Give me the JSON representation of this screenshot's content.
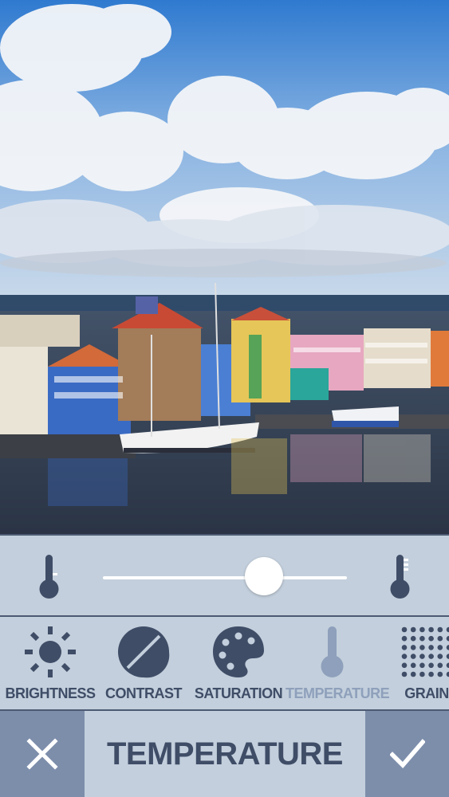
{
  "photo": {
    "description_icon": "image"
  },
  "slider": {
    "low_icon": "thermometer-low-icon",
    "high_icon": "thermometer-high-icon",
    "value": 0.66
  },
  "tools": [
    {
      "label": "BRIGHTNESS",
      "icon": "sun-icon",
      "active": false
    },
    {
      "label": "CONTRAST",
      "icon": "contrast-icon",
      "active": false
    },
    {
      "label": "SATURATION",
      "icon": "palette-icon",
      "active": false
    },
    {
      "label": "TEMPERATURE",
      "icon": "thermometer-icon",
      "active": true
    },
    {
      "label": "GRAIN",
      "icon": "grain-icon",
      "active": false
    }
  ],
  "bottom": {
    "title": "TEMPERATURE",
    "cancel_icon": "close-icon",
    "confirm_icon": "check-icon"
  },
  "colors": {
    "panel": "#c3cfdc",
    "icon": "#3f4d67",
    "icon_inactive": "#8ea0bb",
    "side_button": "#7d8eab"
  }
}
